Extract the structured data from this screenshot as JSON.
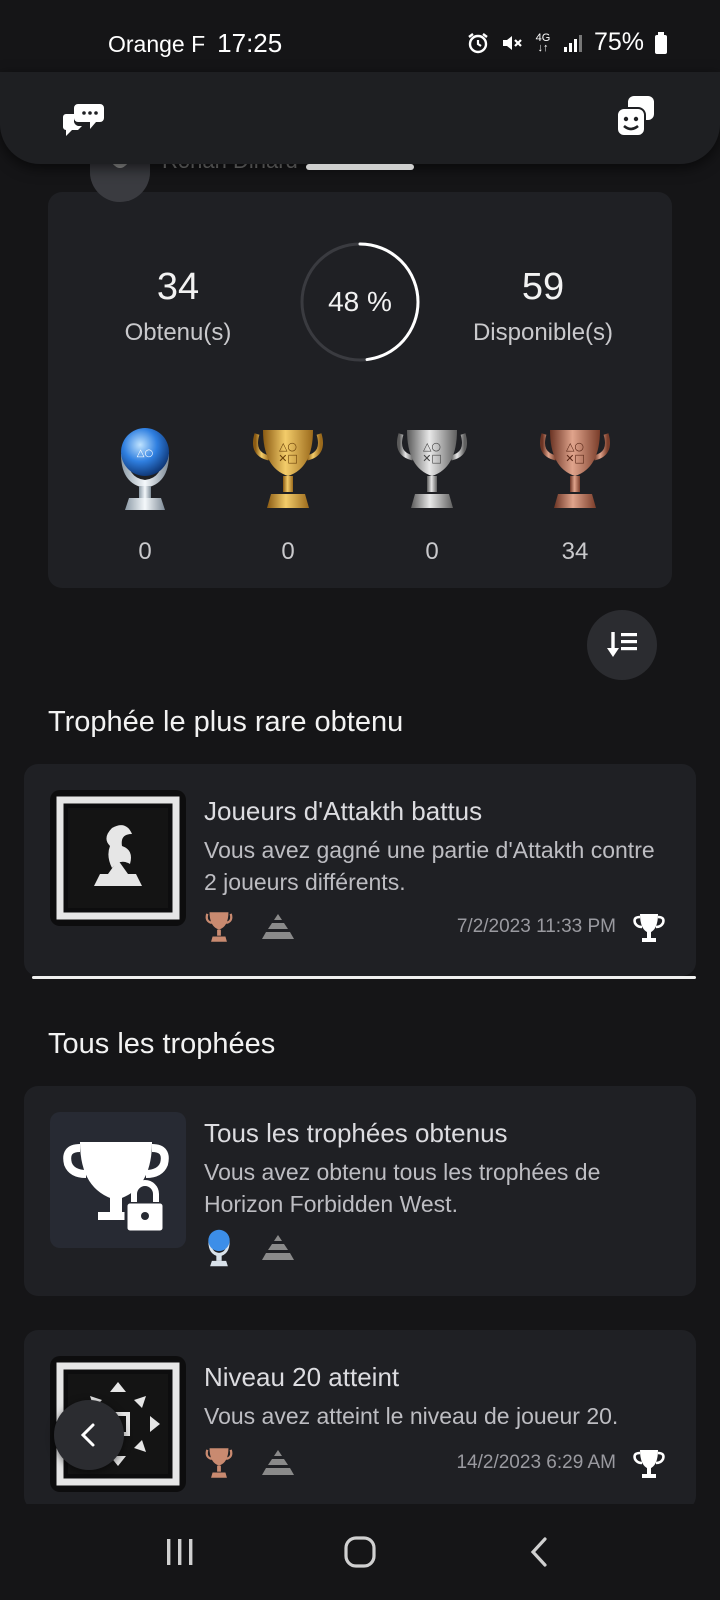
{
  "status_bar": {
    "carrier": "Orange F",
    "time": "17:25",
    "network": "4G",
    "battery": "75%",
    "icons": [
      "alarm-icon",
      "mute-icon",
      "network-4g-icon",
      "signal-icon",
      "battery-icon"
    ]
  },
  "top_bar": {
    "icons": [
      "chat-icon",
      "friends-icon"
    ]
  },
  "profile": {
    "name": "Ronan Dinard"
  },
  "summary": {
    "earned_count": "34",
    "earned_label": "Obtenu(s)",
    "progress_text": "48 %",
    "progress_value": 0.48,
    "available_count": "59",
    "available_label": "Disponible(s)",
    "trophies": [
      {
        "type": "platinum",
        "count": "0"
      },
      {
        "type": "gold",
        "count": "0"
      },
      {
        "type": "silver",
        "count": "0"
      },
      {
        "type": "bronze",
        "count": "34"
      }
    ]
  },
  "sections": {
    "rarest_title": "Trophée le plus rare obtenu",
    "all_title": "Tous les trophées"
  },
  "rarest": {
    "title": "Joueurs d'Attakth battus",
    "description": "Vous avez gagné une partie d'Attakth contre 2 joueurs différents.",
    "date": "7/2/2023  11:33 PM",
    "grade": "bronze",
    "rarity_icon": "rarity-pyramid-icon"
  },
  "trophy_list": [
    {
      "title": "Tous les trophées obtenus",
      "description": "Vous avez obtenu tous les trophées de Horizon Forbidden West.",
      "grade": "platinum",
      "locked": true
    },
    {
      "title": "Niveau 20 atteint",
      "description": "Vous avez atteint le niveau de joueur 20.",
      "date": "14/2/2023  6:29 AM",
      "grade": "bronze"
    }
  ],
  "colors": {
    "background": "#151517",
    "card": "#1f2024",
    "bronze": "#b06a4f",
    "gold": "#d4a23c",
    "silver": "#b8b8b8",
    "platinum": "#4aa3ff"
  }
}
